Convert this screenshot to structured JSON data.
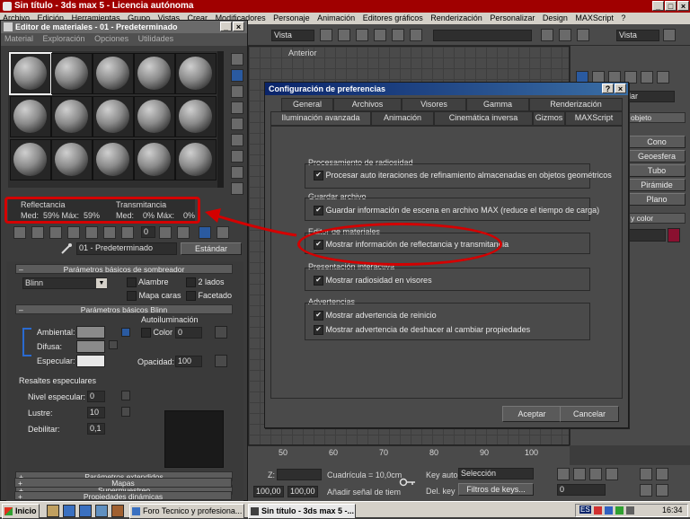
{
  "main_window": {
    "title": "Sin título - 3ds max 5 - Licencia autónoma",
    "menu": [
      "Archivo",
      "Edición",
      "Herramientas",
      "Grupo",
      "Vistas",
      "Crear",
      "Modificadores",
      "Personaje",
      "Animación",
      "Editores gráficos",
      "Renderización",
      "Personalizar",
      "Design",
      "MAXScript",
      "?"
    ],
    "toolbar": {
      "vista1": "Vista",
      "vista2": "Vista"
    },
    "viewport_label": "Anterior"
  },
  "command_panel": {
    "rollout_title": "objeto",
    "dropdown": "ndar",
    "buttons": [
      "Cono",
      "Geoesfera",
      "Tubo",
      "Pirámide",
      "Plano"
    ],
    "color_label": "y color"
  },
  "material_editor": {
    "title": "Editor de materiales - 01 - Predeterminado",
    "menu": [
      "Material",
      "Exploración",
      "Opciones",
      "Utilidades"
    ],
    "reflectance_label": "Reflectancia",
    "reflectance_values": "Med:  59% Máx:  59%",
    "transmittance_label": "Transmitancia",
    "transmittance_values": "Med:    0% Máx:    0%",
    "zero_field": "0",
    "material_name": "01 - Predeterminado",
    "material_type": "Estándar",
    "shader_rollout": "Parámetros básicos de sombreador",
    "shader": "Blinn",
    "wire": "Alambre",
    "two_sided": "2 lados",
    "face_map": "Mapa caras",
    "faceted": "Facetado",
    "blinn_rollout": "Parámetros básicos Blinn",
    "self_illum": "Autoiluminación",
    "color_label": "Color",
    "color_value": "0",
    "ambient": "Ambiental:",
    "diffuse": "Difusa:",
    "specular": "Especular:",
    "opacity": "Opacidad:",
    "opacity_value": "100",
    "spec_highlights": "Resaltes especulares",
    "spec_level": "Nivel especular:",
    "spec_level_value": "0",
    "glossiness": "Lustre:",
    "glossiness_value": "10",
    "soften": "Debilitar:",
    "soften_value": "0,1",
    "rollouts_collapsed": [
      "Parámetros extendidos",
      "Supermuestreo",
      "Mapas",
      "Propiedades dinámicas"
    ]
  },
  "preferences_dialog": {
    "title": "Configuración de preferencias",
    "tabs_row1": [
      "General",
      "Archivos",
      "Visores",
      "Gamma",
      "Renderización"
    ],
    "tabs_row2": [
      "Iluminación avanzada",
      "Animación",
      "Cinemática inversa",
      "Gizmos",
      "MAXScript"
    ],
    "groups": [
      {
        "label": "Procesamiento de radiosidad",
        "options": [
          "Procesar auto iteraciones de refinamiento almacenadas en objetos geométricos"
        ]
      },
      {
        "label": "Guardar archivo",
        "options": [
          "Guardar información de escena en archivo MAX (reduce el tiempo de carga)"
        ]
      },
      {
        "label": "Editor de materiales",
        "options": [
          "Mostrar información de reflectancia y transmitancia"
        ]
      },
      {
        "label": "Presentación interactiva",
        "options": [
          "Mostrar radiosidad en visores"
        ]
      },
      {
        "label": "Advertencias",
        "options": [
          "Mostrar advertencia de reinicio",
          "Mostrar advertencia de deshacer al cambiar propiedades"
        ]
      }
    ],
    "accept": "Aceptar",
    "cancel": "Cancelar"
  },
  "timeline": {
    "ticks": [
      "50",
      "60",
      "70",
      "80",
      "90",
      "100"
    ]
  },
  "status_bar": {
    "z_label": "Z:",
    "grid": "Cuadrícula = 10,0cm",
    "key_auto": "Key auto",
    "selection": "Selección",
    "del_key": "Del. key",
    "key_filters": "Filtros de keys...",
    "add_time_tag": "Añadir señal de tiem",
    "coord1": "100,00",
    "coord2": "100,00",
    "frame": "0"
  },
  "taskbar": {
    "start": "Inicio",
    "tasks": [
      "Foro Tecnico y profesiona...",
      "Sin título - 3ds max 5 -..."
    ],
    "lang": "ES",
    "clock": "16:34"
  },
  "colors": {
    "max_title": "#a00000",
    "dialog_title_start": "#0a246a",
    "annotation_red": "#d40000",
    "ui_dark": "#3c3c3c",
    "swatch_red": "#8a1030"
  }
}
